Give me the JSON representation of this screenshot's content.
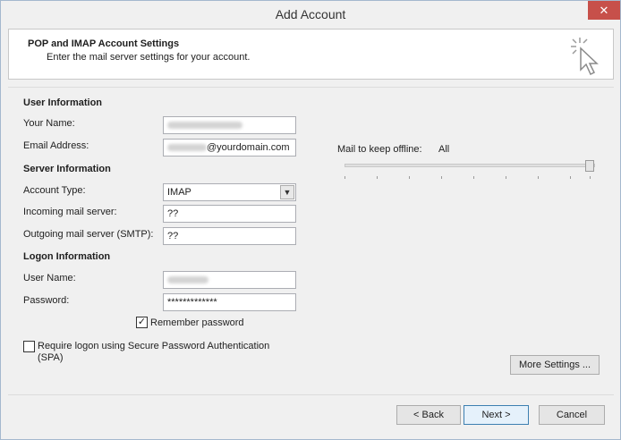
{
  "window": {
    "title": "Add Account",
    "close_glyph": "✕"
  },
  "header": {
    "title": "POP and IMAP Account Settings",
    "subtitle": "Enter the mail server settings for your account.",
    "icon": "cursor-sparkle-icon"
  },
  "user_info": {
    "section": "User Information",
    "name_label": "Your Name:",
    "email_label": "Email Address:",
    "email_domain": "@yourdomain.com"
  },
  "server_info": {
    "section": "Server Information",
    "account_type_label": "Account Type:",
    "account_type_value": "IMAP",
    "incoming_label": "Incoming mail server:",
    "incoming_value": "??",
    "outgoing_label": "Outgoing mail server (SMTP):",
    "outgoing_value": "??"
  },
  "logon_info": {
    "section": "Logon Information",
    "user_label": "User Name:",
    "password_label": "Password:",
    "password_value": "*************",
    "remember_label": "Remember password",
    "remember_checked": true,
    "spa_label_1": "Require logon using Secure Password Authentication",
    "spa_label_2": "(SPA)",
    "spa_checked": false
  },
  "offline": {
    "label": "Mail to keep offline:",
    "value": "All",
    "slider_level": 1.0
  },
  "buttons": {
    "more_settings": "More Settings ...",
    "back": "< Back",
    "next": "Next >",
    "cancel": "Cancel"
  }
}
